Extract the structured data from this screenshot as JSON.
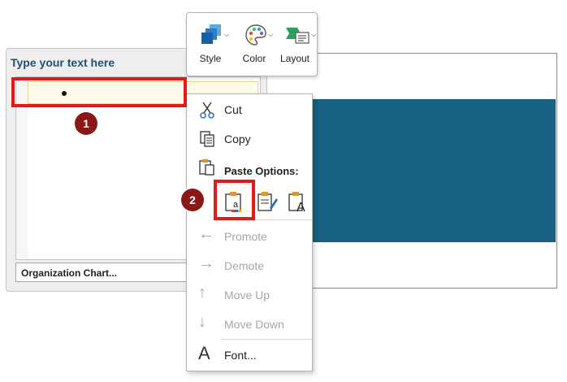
{
  "text_pane": {
    "title": "Type your text here",
    "org_chart_button": "Organization Chart..."
  },
  "mini_toolbar": {
    "items": [
      {
        "label": "Style",
        "icon": "smartart-style-icon"
      },
      {
        "label": "Color",
        "icon": "palette-icon"
      },
      {
        "label": "Layout",
        "icon": "smartart-layout-icon"
      }
    ]
  },
  "context_menu": {
    "cut": "Cut",
    "copy": "Copy",
    "paste_options_heading": "Paste Options:",
    "promote": "Promote",
    "demote": "Demote",
    "move_up": "Move Up",
    "move_down": "Move Down",
    "font": "Font..."
  },
  "callouts": {
    "step1": "1",
    "step2": "2"
  },
  "colors": {
    "accent_red": "#e21a1a",
    "badge": "#8b1717",
    "shape_fill": "#176184",
    "pane_title": "#1f4e79"
  }
}
